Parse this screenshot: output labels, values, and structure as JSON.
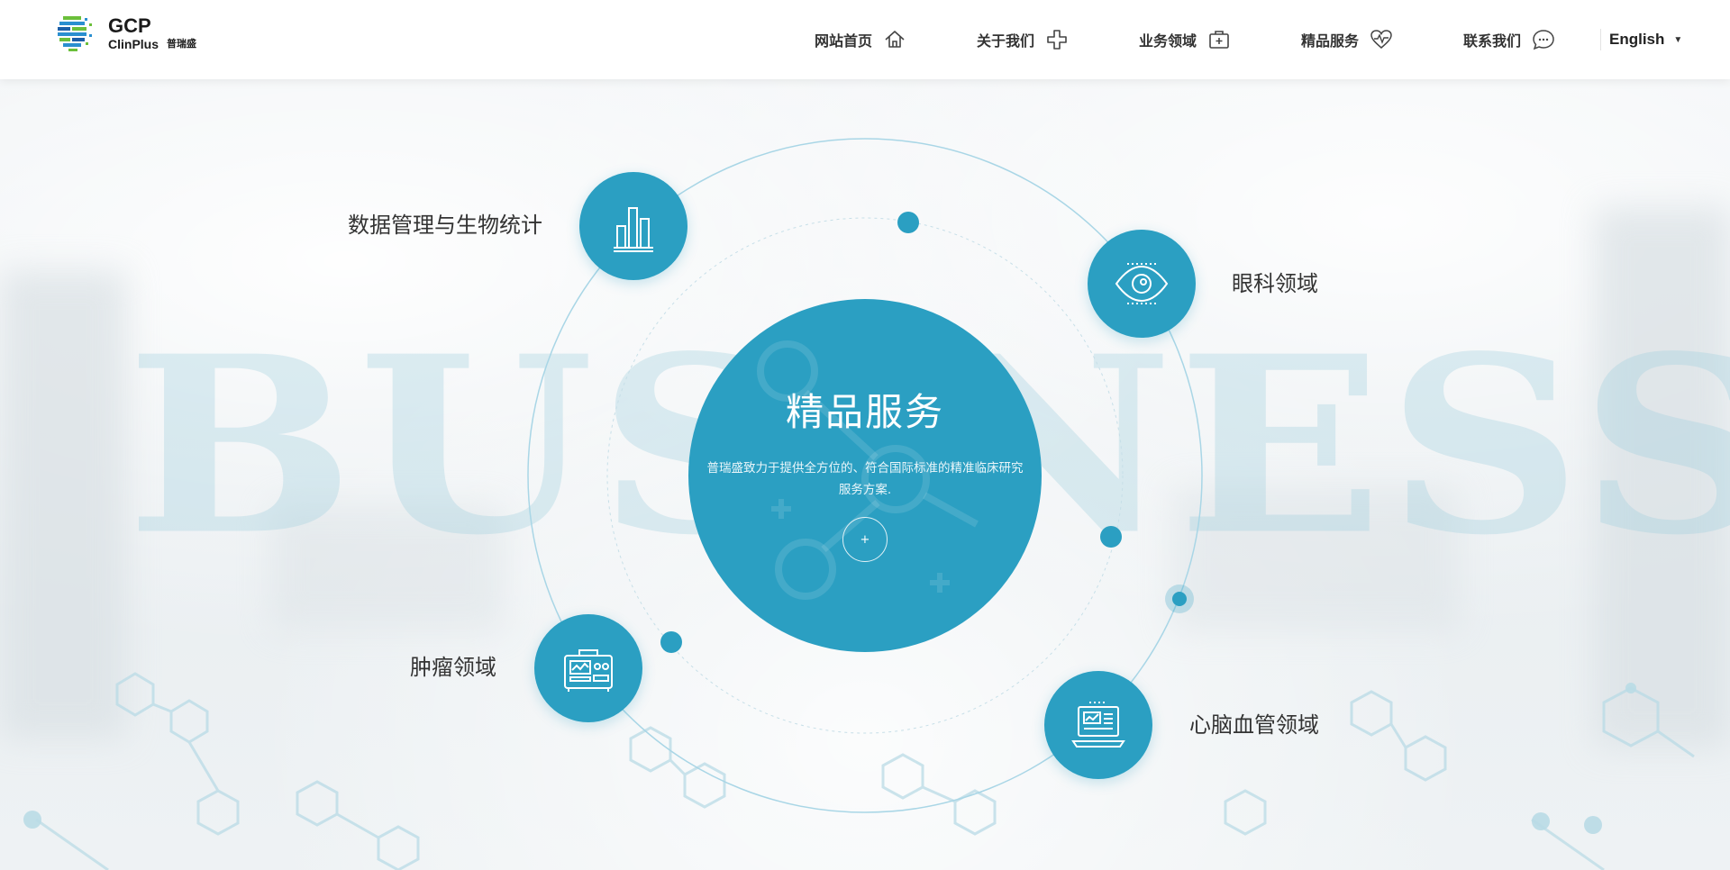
{
  "header": {
    "logo": {
      "gcp": "GCP",
      "clinplus": "ClinPlus",
      "cn": "普瑞盛"
    },
    "nav": [
      {
        "label": "网站首页",
        "icon": "home-icon"
      },
      {
        "label": "关于我们",
        "icon": "plus-cross-icon"
      },
      {
        "label": "业务领域",
        "icon": "medical-kit-icon"
      },
      {
        "label": "精品服务",
        "icon": "heart-pulse-icon"
      },
      {
        "label": "联系我们",
        "icon": "chat-bubble-icon"
      }
    ],
    "language": {
      "label": "English",
      "caret": "▼"
    }
  },
  "background": {
    "watermark": "BUSINESS"
  },
  "center": {
    "title": "精品服务",
    "description": "普瑞盛致力于提供全方位的、符合国际标准的精准临床研究服务方案.",
    "more_button": "+"
  },
  "satellites": [
    {
      "label": "数据管理与生物统计",
      "icon": "bar-chart-icon"
    },
    {
      "label": "眼科领域",
      "icon": "eye-icon"
    },
    {
      "label": "肿瘤领域",
      "icon": "medical-device-icon"
    },
    {
      "label": "心脑血管领域",
      "icon": "laptop-chart-icon"
    }
  ],
  "colors": {
    "accent": "#2b9fc2",
    "ring": "#a9d6e6",
    "text": "#333333"
  }
}
